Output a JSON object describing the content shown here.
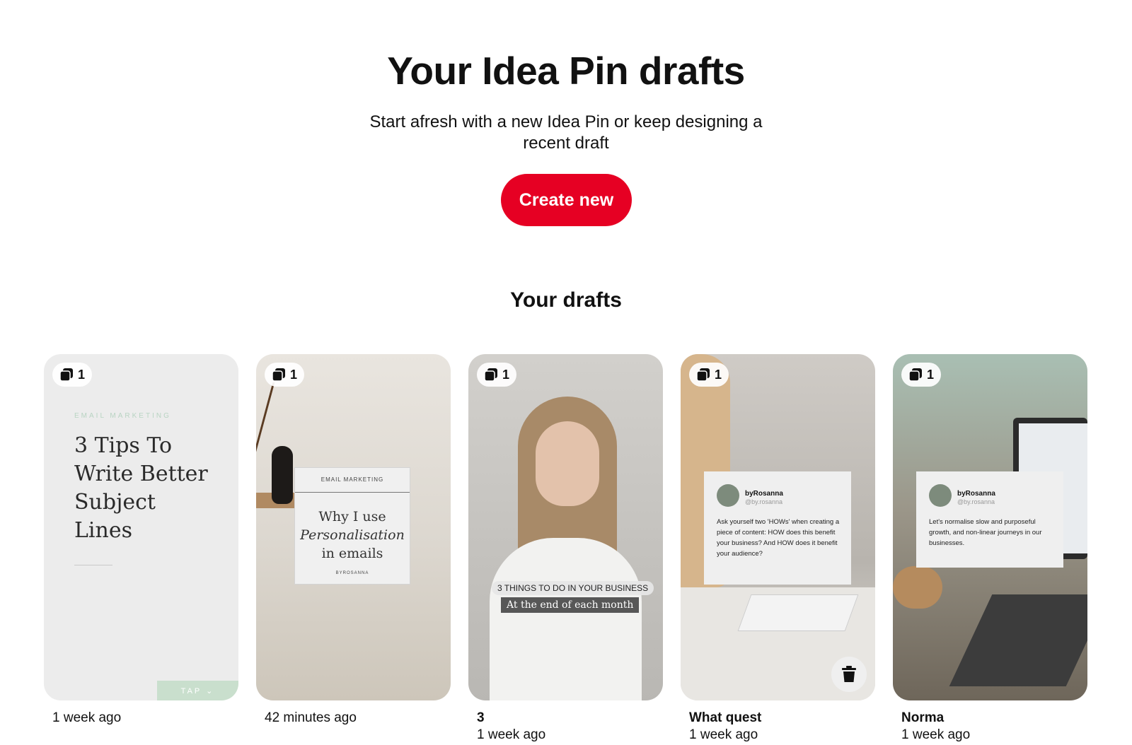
{
  "header": {
    "title": "Your Idea Pin drafts",
    "subtitle": "Start afresh with a new Idea Pin or keep designing a recent draft",
    "create_label": "Create new"
  },
  "section_title": "Your drafts",
  "colors": {
    "primary": "#e60023",
    "text": "#111111",
    "badge_bg": "#ffffff"
  },
  "drafts": [
    {
      "count": "1",
      "title": "",
      "time": "1 week ago",
      "thumb": {
        "eyebrow": "EMAIL MARKETING",
        "headline": "3 Tips To Write Better Subject Lines",
        "tap": "TAP ⌄"
      }
    },
    {
      "count": "1",
      "title": "",
      "time": "42 minutes ago",
      "thumb": {
        "eyebrow": "EMAIL MARKETING",
        "line1": "Why I use",
        "line2": "Personalisation",
        "line3": "in emails",
        "byline": "BYROSANNA"
      }
    },
    {
      "count": "1",
      "title": "3",
      "time": "1 week ago",
      "thumb": {
        "caption1": "3 THINGS TO DO IN YOUR BUSINESS",
        "caption2": "At the end of each month"
      }
    },
    {
      "count": "1",
      "title": "What quest",
      "time": "1 week ago",
      "thumb": {
        "name": "byRosanna",
        "handle": "@by.rosanna",
        "body": "Ask yourself two 'HOWs' when creating a piece of content: HOW does this benefit your business? And HOW does it benefit your audience?"
      },
      "delete_icon": "trash-icon"
    },
    {
      "count": "1",
      "title": "Norma",
      "time": "1 week ago",
      "thumb": {
        "name": "byRosanna",
        "handle": "@by.rosanna",
        "body": "Let's normalise slow and purposeful growth, and non-linear journeys in our businesses."
      }
    }
  ]
}
